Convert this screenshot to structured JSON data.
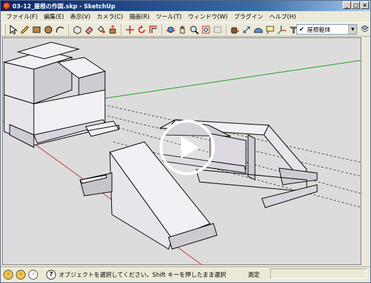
{
  "window": {
    "title": "03-12_屋根の作図.skp - SketchUp",
    "controls": [
      "_",
      "□",
      "×"
    ]
  },
  "menu": {
    "items": [
      "ファイル(F)",
      "編集(E)",
      "表示(V)",
      "カメラ(C)",
      "描画(R)",
      "ツール(T)",
      "ウィンドウ(W)",
      "プラグイン",
      "ヘルプ(H)"
    ]
  },
  "toolbar": {
    "icons": [
      "select-icon",
      "pencil-icon",
      "rectangle-icon",
      "circle-icon",
      "arc-icon",
      "make-component-icon",
      "eraser-icon",
      "paint-bucket-icon",
      "push-pull-icon",
      "move-icon",
      "rotate-icon",
      "offset-icon",
      "orbit-icon",
      "pan-icon",
      "zoom-icon",
      "zoom-extents-icon",
      "previous-view-icon",
      "tape-measure-icon",
      "dimension-icon",
      "protractor-icon",
      "text-icon",
      "axes-icon",
      "3d-text-icon"
    ],
    "layer_name": "屋根躯体",
    "layer_check": "✔"
  },
  "status": {
    "message": "オブジェクトを選択してください。Shift キーを押したまま選択",
    "measure_label": "測定",
    "help": "?"
  },
  "colors": {
    "viewport_bg": "#dcdcdc",
    "green_axis": "#1a9a1a",
    "red_axis": "#c83232",
    "face": "#f2f0f4",
    "face_shadow": "#cfcbd3",
    "edge": "#000000"
  }
}
